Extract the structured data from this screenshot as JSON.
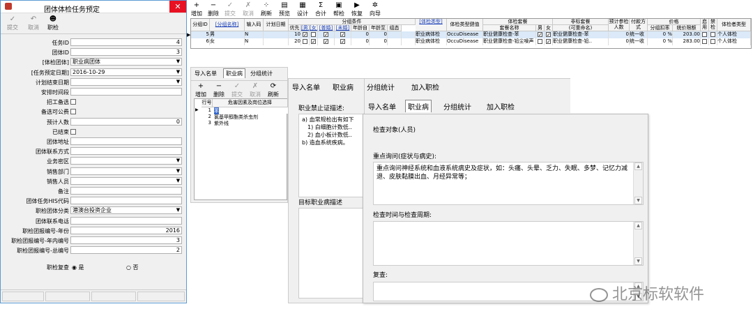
{
  "left": {
    "title": "团体体检任务预定",
    "toolbar": [
      "提交",
      "取消",
      "职检"
    ],
    "fields": [
      {
        "label": "任务ID",
        "value": "4",
        "type": "num"
      },
      {
        "label": "团体ID",
        "value": "3",
        "type": "num"
      },
      {
        "label": "[体检团体]",
        "value": "职业病团体",
        "type": "dd"
      },
      {
        "label": "[任务预定日期]",
        "value": "2016-10-29",
        "type": "dd"
      },
      {
        "label": "计划结束日期",
        "value": "",
        "type": "dd"
      },
      {
        "label": "安排时间段",
        "value": "",
        "type": "txt"
      },
      {
        "label": "招工备选",
        "value": "",
        "type": "cb"
      },
      {
        "label": "备选可公费",
        "value": "",
        "type": "cb"
      },
      {
        "label": "预计人数",
        "value": "0",
        "type": "num"
      },
      {
        "label": "已结束",
        "value": "",
        "type": "cb"
      },
      {
        "label": "团体地址",
        "value": "",
        "type": "txt"
      },
      {
        "label": "团体联系方式",
        "value": "",
        "type": "txt"
      },
      {
        "label": "业务密区",
        "value": "",
        "type": "dd"
      },
      {
        "label": "销售部门",
        "value": "",
        "type": "dd"
      },
      {
        "label": "销售人员",
        "value": "",
        "type": "dd"
      },
      {
        "label": "备注",
        "value": "",
        "type": "txt"
      },
      {
        "label": "团体任务HIS代码",
        "value": "",
        "type": "txt"
      },
      {
        "label": "职检团体分类",
        "value": "港澳台投资企业",
        "type": "dd"
      },
      {
        "label": "团体联系电话",
        "value": "",
        "type": "txt"
      },
      {
        "label": "职检团报编号-年份",
        "value": "2016",
        "type": "num"
      },
      {
        "label": "职检团报编号-年内编号",
        "value": "3",
        "type": "num"
      },
      {
        "label": "职检团报编号-总编号",
        "value": "2",
        "type": "num"
      }
    ],
    "review_label": "职检复查",
    "review_yes": "是",
    "review_no": "否"
  },
  "toolbar": [
    "增加",
    "删除",
    "提交",
    "取消",
    "刷新",
    "预览",
    "设计",
    "合计",
    "帮检",
    "恢复",
    "向导"
  ],
  "grid": {
    "headers": {
      "id": "分组ID",
      "name": "[分组名称]",
      "code": "输入码",
      "plan": "计划日期",
      "cond": "分组条件",
      "prio": "优先",
      "male": "[男]",
      "female": "[女]",
      "married": "[普婚]",
      "unmarried": "[未婚]",
      "agefrom": "年龄自",
      "ageto": "年龄至",
      "grp": "组态",
      "exam": "[体检类型]",
      "etype": "体检类型健值",
      "pkg": "体检套餐",
      "pkgname": "套餐名称",
      "m": "男",
      "f": "女",
      "nonstd": "非标套餐",
      "nonstd2": "(可重命名)",
      "est": "预计参检人数",
      "pay": "付款方式",
      "price": "价格",
      "disc": "分组扣率",
      "std": "统价限额",
      "en": "启用",
      "fz": "禁检",
      "who": "体检者类型"
    },
    "rows": [
      {
        "id": "5",
        "name": "男",
        "code": "N",
        "prio": "10",
        "exam": "职业病体检",
        "etype": "OccuDisease",
        "pkgname": "职业健康检查-苯",
        "nonstd": "职业健康检查-苯",
        "est": "0",
        "pay": "统一收",
        "disc": "0 %",
        "std": "203.00",
        "who": "个人体检"
      },
      {
        "id": "6",
        "name": "女",
        "code": "N",
        "prio": "20",
        "exam": "职业病体检",
        "etype": "OccuDisease",
        "pkgname": "职业健康检查-铅尘噪声",
        "nonstd": "职业健康检查-铅..",
        "est": "0",
        "pay": "统一收",
        "disc": "0 %",
        "std": "283.00",
        "who": "个人体检"
      }
    ]
  },
  "mid": {
    "tabs": [
      "导入名单",
      "职业病",
      "分组统计"
    ],
    "toolbar": [
      "增加",
      "删除",
      "提交",
      "取消",
      "刷新"
    ],
    "headers": [
      "行号",
      "危害因素及岗位选择"
    ],
    "rows": [
      {
        "n": "1",
        "v": "苯"
      },
      {
        "n": "2",
        "v": "氯基甲醇酯类杀虫剂"
      },
      {
        "n": "3",
        "v": "紫外线"
      }
    ]
  },
  "panel": {
    "tabs": [
      "导入名单",
      "职业病",
      "分组统计",
      "加入职检"
    ],
    "forbid_label": "职业禁止证描述:",
    "forbid_lines": [
      "a) 血常规检出有如下",
      "1) 白细胞计数低..",
      "2) 血小板计数低..",
      "b) 造血系统疾病。"
    ],
    "target_label": "目标职业病描述"
  },
  "dialog": {
    "tabs": [
      "导入名单",
      "职业病",
      "分组统计",
      "加入职检"
    ],
    "obj_label": "检查对象(人员)",
    "key_label": "重点询问(症状与病史):",
    "key_text": "重点询问神经系统和血液系统病史及症状，如：头痛、头晕、乏力、失眠、多梦、记忆力减退、皮肤黏膜出血、月经异常等；",
    "time_label": "检查时间与检查周期:",
    "review_label": "复查:"
  },
  "watermark": "北京标软软件"
}
